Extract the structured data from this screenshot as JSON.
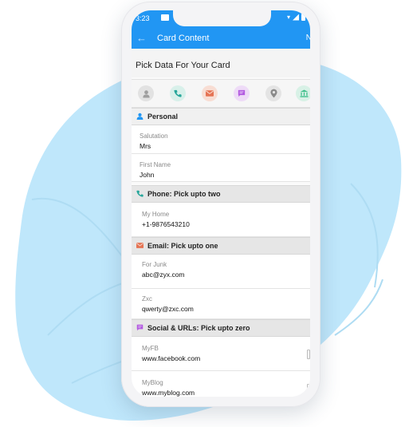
{
  "status_bar": {
    "time": "3:23"
  },
  "app_bar": {
    "back_icon": "back-arrow-icon",
    "title": "Card Content",
    "action_label": "N"
  },
  "pick_header": {
    "title": "Pick Data For Your Card"
  },
  "category_icons": [
    {
      "name": "person-icon",
      "color": "#9e9e9e",
      "bg": "#e2e2e2"
    },
    {
      "name": "phone-icon",
      "color": "#26a69a",
      "bg": "#d8f0ea"
    },
    {
      "name": "email-icon",
      "color": "#e57353",
      "bg": "#f8ddd3"
    },
    {
      "name": "message-icon",
      "color": "#b259e0",
      "bg": "#eedbf7"
    },
    {
      "name": "location-icon",
      "color": "#8a8a8a",
      "bg": "#e4e4e4"
    },
    {
      "name": "bank-icon",
      "color": "#3dbf8a",
      "bg": "#d8f1e6"
    }
  ],
  "sections": {
    "personal": {
      "label": "Personal",
      "icon": "person-icon",
      "color": "#2196f3",
      "fields": [
        {
          "label": "Salutation",
          "value": "Mrs"
        },
        {
          "label": "First Name",
          "value": "John"
        }
      ]
    },
    "phone": {
      "label": "Phone: Pick upto two",
      "icon": "phone-icon",
      "color": "#26a69a",
      "fields": [
        {
          "label": "My Home",
          "value": "+1-9876543210"
        }
      ]
    },
    "email": {
      "label": "Email: Pick upto one",
      "icon": "email-icon",
      "color": "#e57353",
      "fields": [
        {
          "label": "For Junk",
          "value": "abc@zyx.com"
        },
        {
          "label": "Zxc",
          "value": "qwerty@zxc.com"
        }
      ]
    },
    "social": {
      "label": "Social & URLs: Pick upto zero",
      "icon": "message-icon",
      "color": "#b259e0",
      "fields": [
        {
          "label": "MyFB",
          "value": "www.facebook.com"
        },
        {
          "label": "MyBlog",
          "value": "www.myblog.com"
        }
      ]
    }
  },
  "colors": {
    "accent": "#2196f3",
    "blob": "#bfe7fb"
  }
}
